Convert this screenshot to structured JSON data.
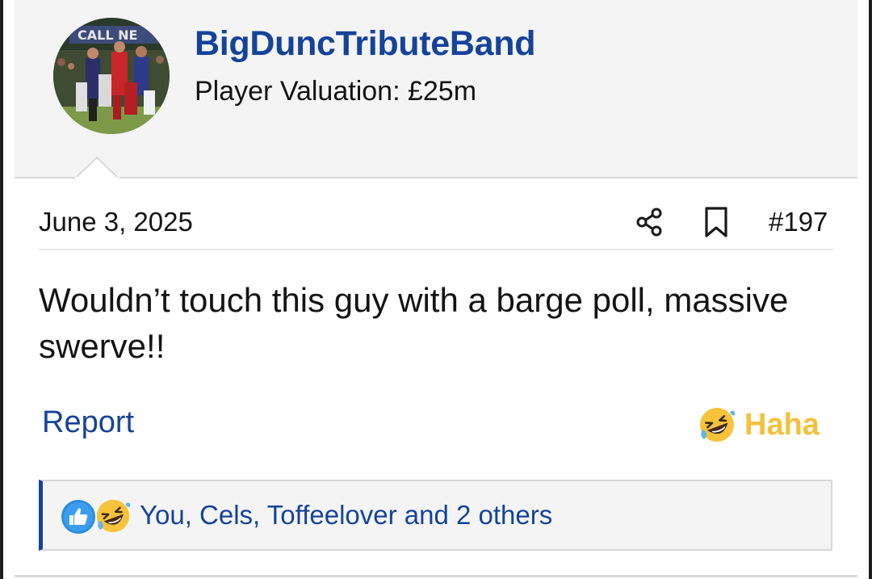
{
  "user": {
    "name": "BigDuncTributeBand",
    "title": "Player Valuation: £25m",
    "avatar_icon": "football-match-photo-avatar"
  },
  "post": {
    "date": "June 3, 2025",
    "number": "#197",
    "body": "Wouldn’t touch this guy with a barge poll, massive swerve!!",
    "share_icon": "share-icon",
    "bookmark_icon": "bookmark-icon"
  },
  "actions": {
    "report_label": "Report",
    "reaction_label": "Haha",
    "reaction_icon": "laughing-emoji-icon"
  },
  "reactions": {
    "summary": "You, Cels, Toffeelover and 2 others",
    "icons": [
      "like-icon",
      "haha-icon"
    ]
  },
  "colors": {
    "brand_blue": "#15439a",
    "haha_yellow": "#f3c13a",
    "panel_bg": "#f4f4f4",
    "border": "#d8d8d8"
  }
}
